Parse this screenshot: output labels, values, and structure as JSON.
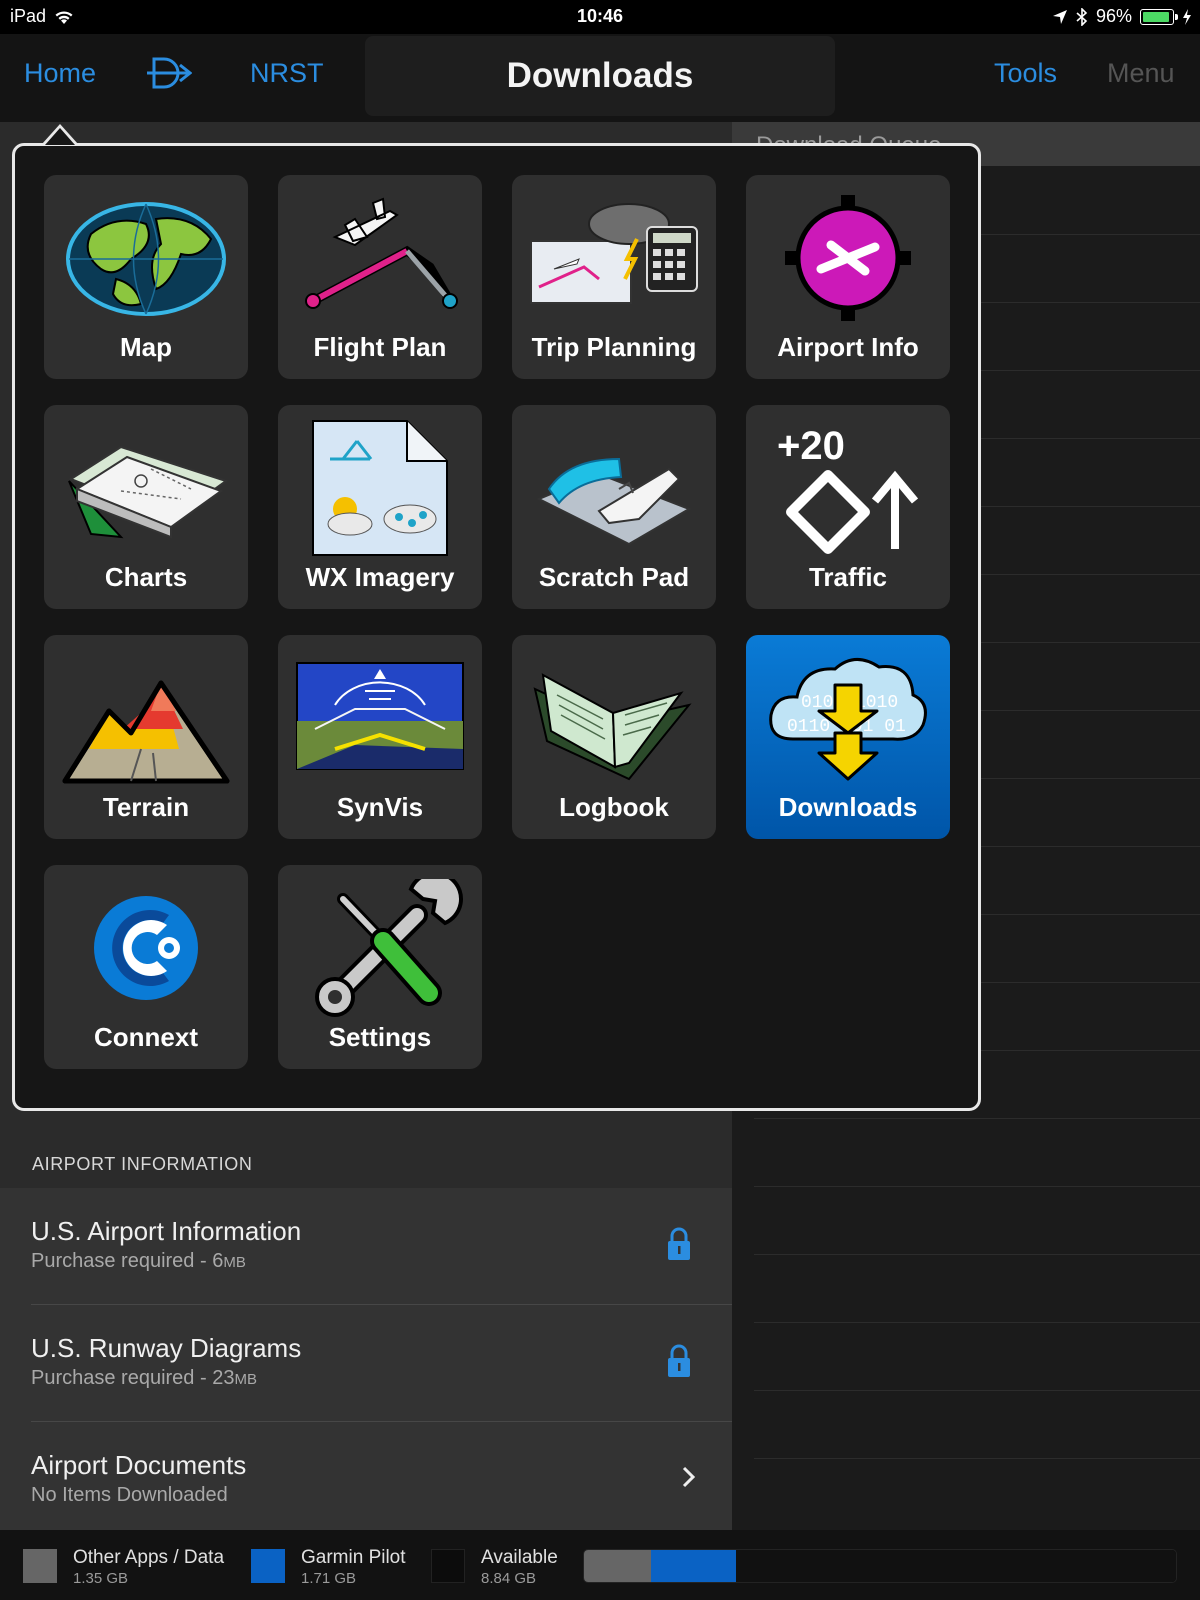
{
  "status_bar": {
    "device": "iPad",
    "time": "10:46",
    "battery": "96%"
  },
  "nav": {
    "home": "Home",
    "nrst": "NRST",
    "title": "Downloads",
    "tools": "Tools",
    "menu": "Menu"
  },
  "queue": {
    "title": "Download Queue"
  },
  "popover": {
    "tiles": [
      {
        "label": "Map",
        "icon": "globe-icon"
      },
      {
        "label": "Flight Plan",
        "icon": "flight-plan-icon"
      },
      {
        "label": "Trip Planning",
        "icon": "trip-planning-icon"
      },
      {
        "label": "Airport Info",
        "icon": "airport-info-icon"
      },
      {
        "label": "Charts",
        "icon": "charts-icon"
      },
      {
        "label": "WX Imagery",
        "icon": "wx-imagery-icon"
      },
      {
        "label": "Scratch Pad",
        "icon": "scratch-pad-icon"
      },
      {
        "label": "Traffic",
        "icon": "traffic-icon",
        "badge": "+20"
      },
      {
        "label": "Terrain",
        "icon": "terrain-icon"
      },
      {
        "label": "SynVis",
        "icon": "synvis-icon"
      },
      {
        "label": "Logbook",
        "icon": "logbook-icon"
      },
      {
        "label": "Downloads",
        "icon": "downloads-icon",
        "selected": true
      },
      {
        "label": "Connext",
        "icon": "connext-icon"
      },
      {
        "label": "Settings",
        "icon": "settings-icon"
      }
    ]
  },
  "section": {
    "header": "AIRPORT INFORMATION"
  },
  "rows": [
    {
      "title": "U.S. Airport Information",
      "sub": "Purchase required - 6",
      "unit": "MB",
      "icon": "lock-icon"
    },
    {
      "title": "U.S. Runway Diagrams",
      "sub": "Purchase required - 23",
      "unit": "MB",
      "icon": "lock-icon"
    },
    {
      "title": "Airport Documents",
      "sub": "No Items Downloaded",
      "icon": "chevron-right-icon"
    }
  ],
  "storage": {
    "items": [
      {
        "label": "Other Apps / Data",
        "size": "1.35 GB",
        "color": "#666666",
        "gb": 1.35
      },
      {
        "label": "Garmin Pilot",
        "size": "1.71 GB",
        "color": "#0a62c4",
        "gb": 1.71
      },
      {
        "label": "Available",
        "size": "8.84 GB",
        "color": "#111111",
        "gb": 8.84
      }
    ]
  },
  "colors": {
    "accent": "#2b8de0",
    "selected_tile": "#0a7bd6"
  }
}
